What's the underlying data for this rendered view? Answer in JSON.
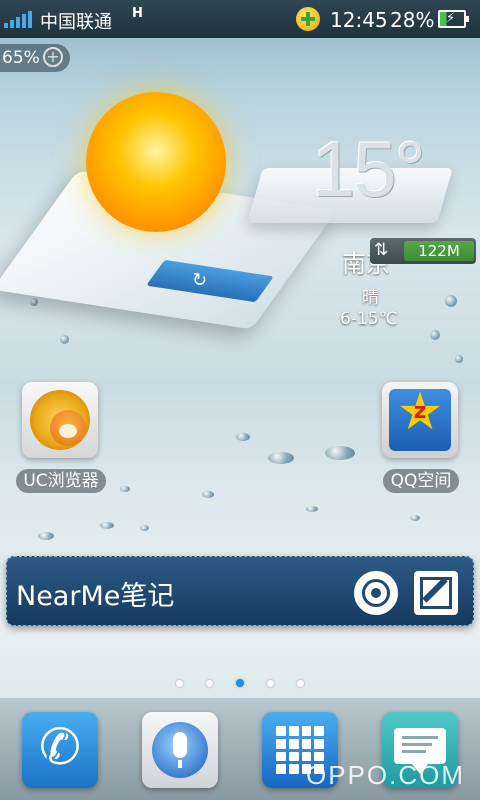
{
  "status_bar": {
    "carrier": "中国联通",
    "network_type": "H",
    "time": "12:45",
    "battery_percent": "28%",
    "battery_level": 0.28,
    "signal_icon": "signal-bars-icon",
    "notification_icon": "plus-badge-icon",
    "battery_icon": "battery-charging-icon"
  },
  "memory_widget": {
    "percent": "65%",
    "action_icon": "plus-circle-icon"
  },
  "weather": {
    "temperature": "15°",
    "city": "南京",
    "condition": "晴",
    "range": "6-15℃",
    "condition_icon": "sun-icon",
    "refresh_icon": "refresh-icon"
  },
  "traffic_widget": {
    "value": "122M",
    "icon": "up-down-arrows-icon"
  },
  "apps": [
    {
      "label": "UC浏览器",
      "icon": "uc-browser-icon"
    },
    {
      "label": "QQ空间",
      "icon": "qzone-icon"
    }
  ],
  "note_widget": {
    "title": "NearMe笔记",
    "camera_icon": "camera-shutter-icon",
    "edit_icon": "edit-note-icon"
  },
  "page_indicator": {
    "pages": 5,
    "active": 3
  },
  "dock": [
    {
      "icon": "phone-icon"
    },
    {
      "icon": "voice-microphone-icon"
    },
    {
      "icon": "app-drawer-grid-icon"
    },
    {
      "icon": "messages-icon"
    }
  ],
  "watermark": "OPPO.COM",
  "colors": {
    "accent_blue": "#1f8fe8",
    "note_blue": "#163a5f",
    "traffic_green": "#3e8a36"
  }
}
